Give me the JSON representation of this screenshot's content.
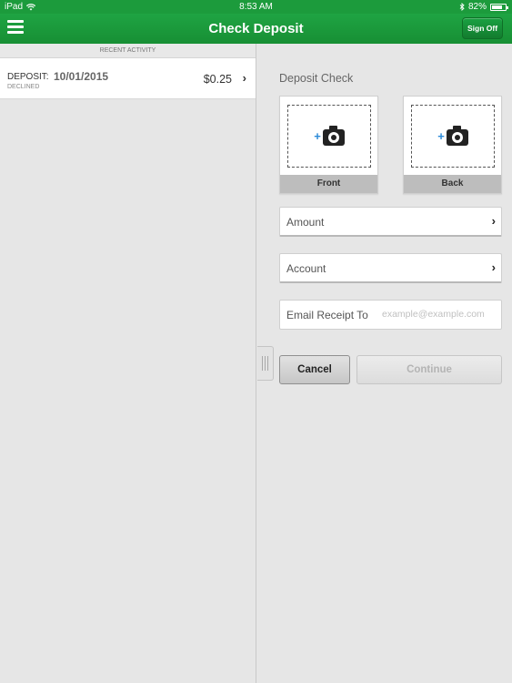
{
  "status_bar": {
    "device": "iPad",
    "time": "8:53 AM",
    "battery": "82%",
    "battery_level": 0.82
  },
  "nav": {
    "title": "Check Deposit",
    "sign_off_label": "Sign Off"
  },
  "recent_activity": {
    "header": "RECENT ACTIVITY",
    "items": [
      {
        "type": "DEPOSIT:",
        "date": "10/01/2015",
        "status": "DECLINED",
        "amount": "$0.25"
      }
    ]
  },
  "deposit": {
    "section_label": "Deposit Check",
    "front_label": "Front",
    "back_label": "Back",
    "amount_label": "Amount",
    "account_label": "Account",
    "email_label": "Email Receipt To",
    "email_value": "",
    "email_placeholder": "example@example.com",
    "cancel_label": "Cancel",
    "continue_label": "Continue"
  },
  "colors": {
    "brand_green": "#1c9b3c",
    "camera_plus_blue": "#2b8ad8"
  }
}
